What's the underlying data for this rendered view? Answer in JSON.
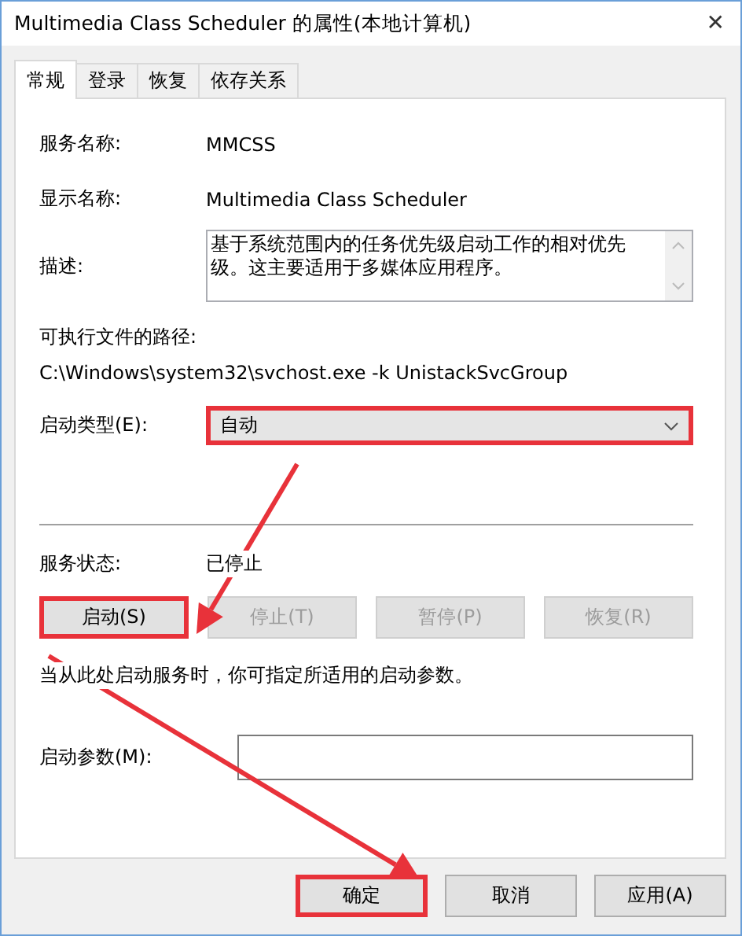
{
  "window": {
    "title": "Multimedia Class Scheduler 的属性(本地计算机)",
    "close": "✕"
  },
  "tabs": [
    {
      "label": "常规",
      "selected": true
    },
    {
      "label": "登录",
      "selected": false
    },
    {
      "label": "恢复",
      "selected": false
    },
    {
      "label": "依存关系",
      "selected": false
    }
  ],
  "general": {
    "service_name": {
      "label": "服务名称:",
      "value": "MMCSS"
    },
    "display_name": {
      "label": "显示名称:",
      "value": "Multimedia Class Scheduler"
    },
    "description": {
      "label": "描述:",
      "value": "基于系统范围内的任务优先级启动工作的相对优先级。这主要适用于多媒体应用程序。"
    },
    "path": {
      "label": "可执行文件的路径:",
      "value": "C:\\Windows\\system32\\svchost.exe -k UnistackSvcGroup"
    },
    "startup_type": {
      "label": "启动类型(E):",
      "value": "自动",
      "highlighted": true
    },
    "status": {
      "label": "服务状态:",
      "value": "已停止"
    },
    "service_buttons": [
      {
        "label": "启动(S)",
        "disabled": false,
        "highlighted": true
      },
      {
        "label": "停止(T)",
        "disabled": true,
        "highlighted": false
      },
      {
        "label": "暂停(P)",
        "disabled": true,
        "highlighted": false
      },
      {
        "label": "恢复(R)",
        "disabled": true,
        "highlighted": false
      }
    ],
    "hint": "当从此处启动服务时，你可指定所适用的启动参数。",
    "parameters": {
      "label": "启动参数(M):"
    }
  },
  "buttons": [
    {
      "label": "确定",
      "highlighted": true
    },
    {
      "label": "取消",
      "highlighted": false
    },
    {
      "label": "应用(A)",
      "highlighted": false
    }
  ]
}
